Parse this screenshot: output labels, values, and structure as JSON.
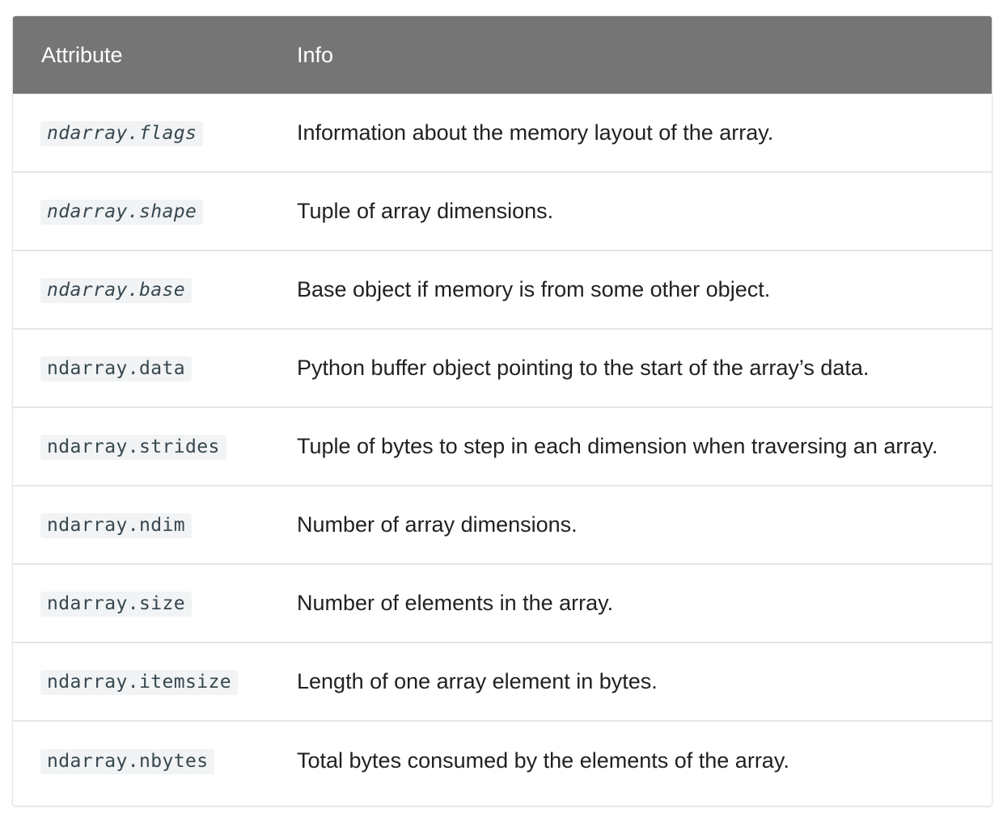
{
  "table": {
    "headers": {
      "attribute": "Attribute",
      "info": "Info"
    },
    "rows": [
      {
        "attribute": "ndarray.flags",
        "info": "Information about the memory layout of the array."
      },
      {
        "attribute": "ndarray.shape",
        "info": "Tuple of array dimensions."
      },
      {
        "attribute": "ndarray.base",
        "info": "Base object if memory is from some other object."
      },
      {
        "attribute": "ndarray.data",
        "info": "Python buffer object pointing to the start of the array’s data."
      },
      {
        "attribute": "ndarray.strides",
        "info": "Tuple of bytes to step in each dimension when traversing an array."
      },
      {
        "attribute": "ndarray.ndim",
        "info": "Number of array dimensions."
      },
      {
        "attribute": "ndarray.size",
        "info": "Number of elements in the array."
      },
      {
        "attribute": "ndarray.itemsize",
        "info": "Length of one array element in bytes."
      },
      {
        "attribute": "ndarray.nbytes",
        "info": "Total bytes consumed by the elements of the array."
      }
    ]
  },
  "colors": {
    "header_background": "#757575",
    "header_text": "#ffffff",
    "code_background": "#f1f3f4",
    "row_divider": "#e5e5e5"
  }
}
